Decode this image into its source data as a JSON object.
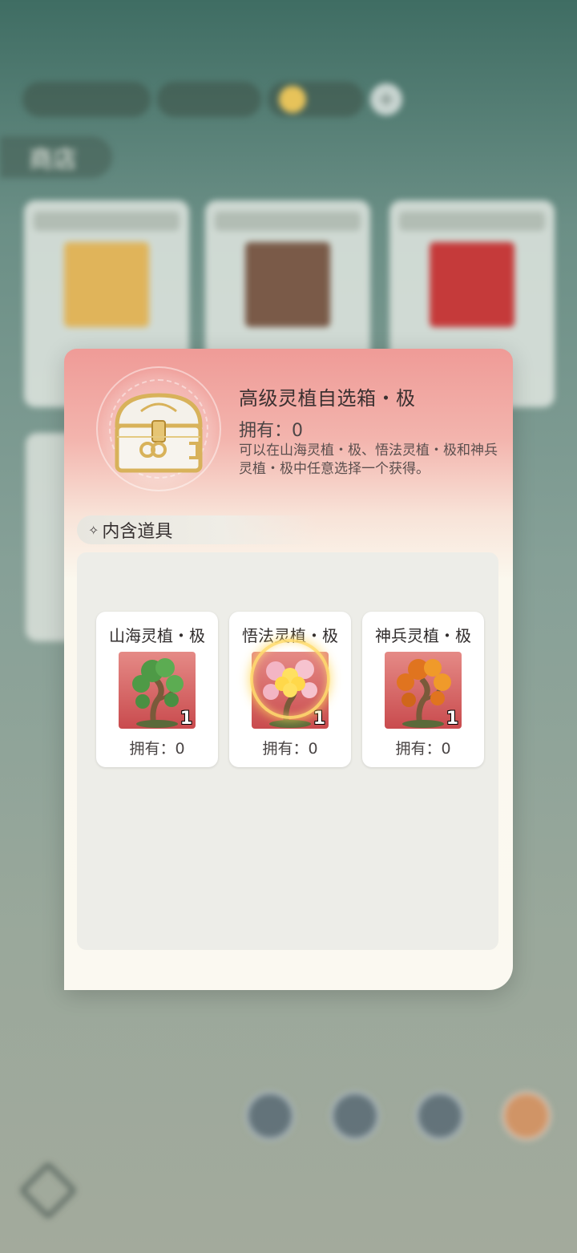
{
  "background": {
    "shop_title": "商店",
    "nav": [
      "",
      "",
      "",
      ""
    ]
  },
  "popup": {
    "title": "高级灵植自选箱・极",
    "owned": "拥有：0",
    "description": "可以在山海灵植・极、悟法灵植・极和神兵灵植・极中任意选择一个获得。",
    "section_label": "内含道具",
    "items": [
      {
        "name": "山海灵植・极",
        "quantity": "1",
        "owned": "拥有：0",
        "foliage": "#4e9a46"
      },
      {
        "name": "悟法灵植・极",
        "quantity": "1",
        "owned": "拥有：0",
        "foliage": "#f3b5c4"
      },
      {
        "name": "神兵灵植・极",
        "quantity": "1",
        "owned": "拥有：0",
        "foliage": "#e0741f"
      }
    ]
  }
}
